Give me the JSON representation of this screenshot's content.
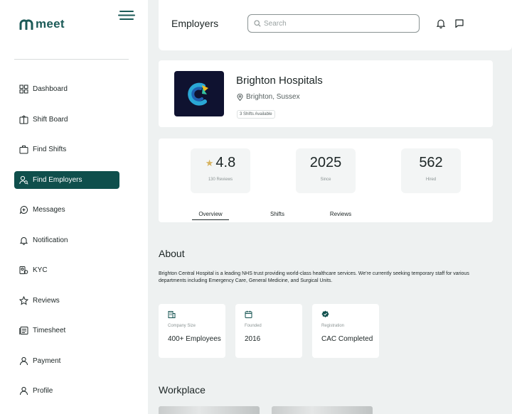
{
  "app": {
    "logo_text": "meet",
    "brand_color": "#0f4f4c"
  },
  "sidebar": {
    "items": [
      {
        "label": "Dashboard",
        "icon": "grid-icon"
      },
      {
        "label": "Shift Board",
        "icon": "shift-board-icon"
      },
      {
        "label": "Find Shifts",
        "icon": "briefcase-icon"
      },
      {
        "label": "Find Employers",
        "icon": "user-search-icon",
        "active": true
      },
      {
        "label": "Messages",
        "icon": "message-icon"
      },
      {
        "label": "Notification",
        "icon": "bell-icon"
      },
      {
        "label": "KYC",
        "icon": "id-icon"
      },
      {
        "label": "Reviews",
        "icon": "star-icon"
      },
      {
        "label": "Timesheet",
        "icon": "timesheet-icon"
      },
      {
        "label": "Payment",
        "icon": "payment-user-icon"
      },
      {
        "label": "Profile",
        "icon": "profile-icon"
      }
    ]
  },
  "header": {
    "title": "Employers",
    "search_placeholder": "Search"
  },
  "employer": {
    "name": "Brighton Hospitals",
    "location": "Brighton, Sussex",
    "badge": "3 Shifts Available"
  },
  "stats": {
    "rating": {
      "value": "4.8",
      "label": "130 Reviews"
    },
    "since": {
      "value": "2025",
      "label": "Since"
    },
    "hired": {
      "value": "562",
      "label": "Hired"
    }
  },
  "tabs": [
    {
      "label": "Overview",
      "active": true
    },
    {
      "label": "Shifts"
    },
    {
      "label": "Reviews"
    }
  ],
  "about": {
    "title": "About",
    "text": "Brighton Central Hospital is a leading NHS trust providing world-class healthcare services. We're currently seeking temporary staff for various departments including Emergency Care, General Medicine, and Surgical Units."
  },
  "info": [
    {
      "label": "Company Size",
      "value": "400+ Employees",
      "icon": "building-icon"
    },
    {
      "label": "Founded",
      "value": "2016",
      "icon": "calendar-icon"
    },
    {
      "label": "Registration",
      "value": "CAC Completed",
      "icon": "verified-badge-icon"
    }
  ],
  "workplace": {
    "title": "Workplace"
  }
}
